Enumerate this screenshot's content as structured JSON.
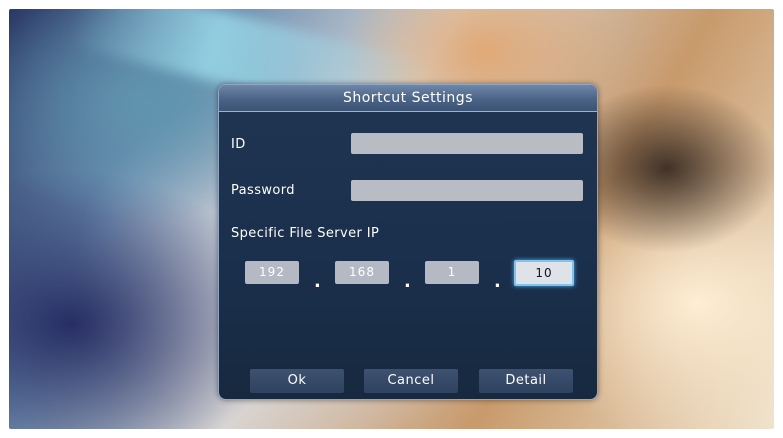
{
  "dialog": {
    "title": "Shortcut Settings",
    "id_label": "ID",
    "id_value": "",
    "password_label": "Password",
    "password_value": "",
    "ip_label": "Specific File Server IP",
    "ip_octets": [
      "192",
      "168",
      "1",
      "10"
    ],
    "ip_separator": ".",
    "active_octet_index": 3,
    "buttons": {
      "ok": "Ok",
      "cancel": "Cancel",
      "detail": "Detail"
    }
  },
  "colors": {
    "dialog_background": "#1a2f4b",
    "title_bar": "#4a6386",
    "field_fill": "#b7bcc5",
    "focus_highlight": "#7cc5f0"
  }
}
